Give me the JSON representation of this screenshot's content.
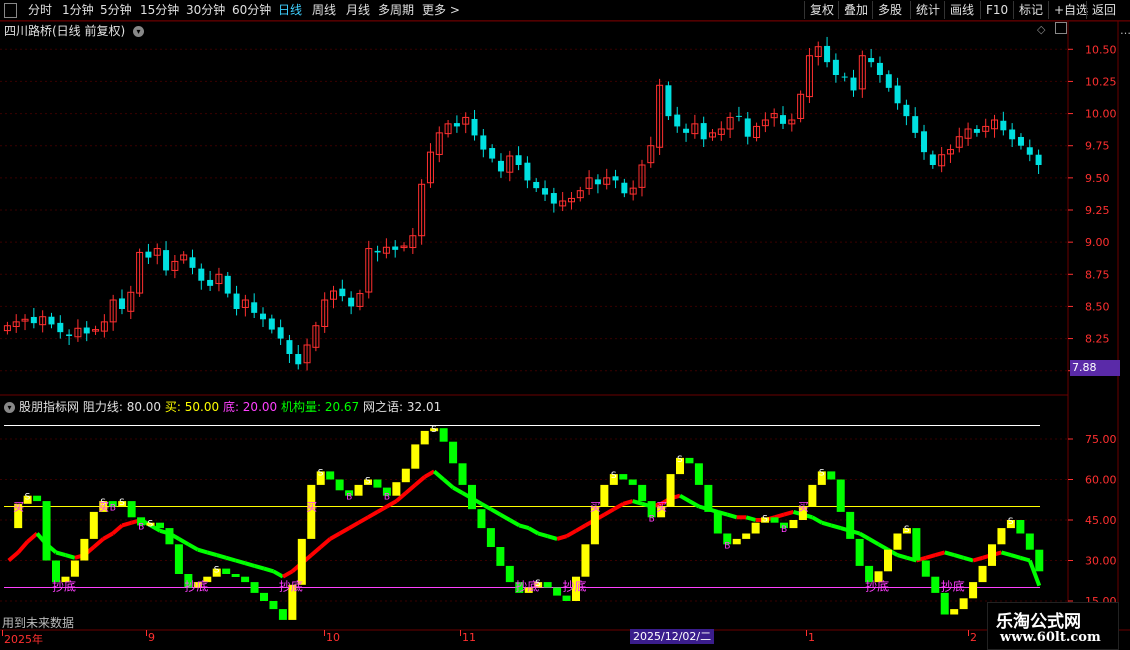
{
  "toolbar": {
    "timeframes": [
      {
        "label": "分时"
      },
      {
        "label": "1分钟"
      },
      {
        "label": "5分钟"
      },
      {
        "label": "15分钟"
      },
      {
        "label": "30分钟"
      },
      {
        "label": "60分钟"
      },
      {
        "label": "日线",
        "active": true
      },
      {
        "label": "周线"
      },
      {
        "label": "月线"
      },
      {
        "label": "多周期"
      },
      {
        "label": "更多 >"
      }
    ],
    "right_buttons": [
      "复权",
      "叠加",
      "多股",
      "统计",
      "画线",
      "F10",
      "标记",
      "+自选",
      "返回"
    ]
  },
  "main": {
    "title": "四川路桥(日线 前复权)",
    "price_tag": "7.88",
    "y_ticks": [
      "10.50",
      "10.25",
      "10.00",
      "9.75",
      "9.50",
      "9.25",
      "9.00",
      "8.75",
      "8.50",
      "8.25",
      "8.00"
    ]
  },
  "indicator": {
    "name": "股朋指标网",
    "resist": "阻力线: 80.00",
    "buy": "买: 50.00",
    "bottom": "底: 20.00",
    "inst": "机构量: 20.67",
    "net": "网之语: 32.01",
    "y_ticks": [
      "75.00",
      "60.00",
      "45.00",
      "30.00",
      "15.00"
    ],
    "bottom_label": "抄底",
    "buy_label": "买",
    "s_label": "S",
    "b_label": "B"
  },
  "x_axis": {
    "labels": [
      "2025年",
      "9",
      "10",
      "11",
      "1",
      "2"
    ],
    "cursor_date": "2025/12/02/二"
  },
  "footer": {
    "future_text": "用到未来数据"
  },
  "watermark": {
    "line1": "乐淘公式网",
    "line2": "www.60lt.com"
  },
  "colors": {
    "up": "#ff3030",
    "down": "#00e0e0",
    "yellow": "#ffff00",
    "green": "#00ff00",
    "red": "#ff0000",
    "magenta": "#ff40ff",
    "white": "#ffffff"
  },
  "chart_data": [
    {
      "type": "candlestick",
      "title": "四川路桥(日线 前复权)",
      "ylim": [
        7.85,
        10.65
      ],
      "close": [
        8.35,
        8.38,
        8.4,
        8.37,
        8.42,
        8.36,
        8.3,
        8.27,
        8.33,
        8.29,
        8.32,
        8.38,
        8.55,
        8.48,
        8.61,
        8.92,
        8.88,
        8.95,
        8.78,
        8.85,
        8.9,
        8.8,
        8.7,
        8.66,
        8.75,
        8.6,
        8.48,
        8.55,
        8.45,
        8.4,
        8.32,
        8.25,
        8.13,
        8.05,
        8.2,
        8.35,
        8.55,
        8.62,
        8.58,
        8.5,
        8.6,
        8.95,
        8.92,
        8.96,
        8.94,
        8.97,
        9.05,
        9.45,
        9.7,
        9.85,
        9.92,
        9.9,
        9.97,
        9.83,
        9.72,
        9.65,
        9.55,
        9.67,
        9.6,
        9.48,
        9.42,
        9.37,
        9.3,
        9.32,
        9.34,
        9.4,
        9.5,
        9.45,
        9.5,
        9.48,
        9.38,
        9.42,
        9.6,
        9.75,
        10.22,
        9.98,
        9.9,
        9.85,
        9.92,
        9.8,
        9.85,
        9.88,
        9.97,
        9.98,
        9.82,
        9.9,
        9.95,
        10.0,
        9.92,
        9.95,
        10.15,
        10.45,
        10.52,
        10.4,
        10.3,
        10.28,
        10.18,
        10.45,
        10.4,
        10.3,
        10.2,
        10.08,
        9.98,
        9.85,
        9.7,
        9.6,
        9.68,
        9.72,
        9.82,
        9.88,
        9.85,
        9.9,
        9.95,
        9.87,
        9.8,
        9.75,
        9.68,
        9.6
      ],
      "x_labels": [
        "2025年",
        "9",
        "10",
        "11",
        "1",
        "2"
      ]
    },
    {
      "type": "line",
      "title": "股朋指标网",
      "ylim": [
        5,
        85
      ],
      "levels": {
        "resist": 80,
        "buy": 50,
        "bottom": 20
      },
      "series": [
        {
          "name": "网之语",
          "values": [
            42,
            51,
            54,
            52,
            30,
            22,
            24,
            30,
            38,
            48,
            52,
            50,
            52,
            46,
            43,
            44,
            42,
            36,
            25,
            20,
            22,
            24,
            27,
            25,
            24,
            22,
            18,
            15,
            12,
            8,
            21,
            38,
            58,
            63,
            60,
            56,
            54,
            58,
            60,
            57,
            54,
            59,
            64,
            73,
            78,
            79,
            74,
            66,
            58,
            49,
            42,
            35,
            28,
            22,
            18,
            20,
            22,
            20,
            17,
            15,
            24,
            36,
            50,
            58,
            62,
            60,
            58,
            52,
            46,
            50,
            62,
            68,
            66,
            58,
            48,
            40,
            36,
            38,
            40,
            44,
            46,
            44,
            42,
            45,
            50,
            58,
            63,
            60,
            48,
            38,
            28,
            22,
            26,
            34,
            40,
            42,
            30,
            24,
            18,
            10,
            12,
            16,
            22,
            28,
            36,
            42,
            45,
            40,
            34,
            26
          ]
        },
        {
          "name": "机构量",
          "values": [
            30,
            33,
            37,
            40,
            36,
            33,
            32,
            31,
            32,
            35,
            38,
            40,
            43,
            44,
            45,
            43,
            41,
            40,
            38,
            36,
            34,
            33,
            32,
            31,
            30,
            29,
            28,
            27,
            26,
            24,
            26,
            29,
            32,
            35,
            38,
            40,
            42,
            44,
            46,
            48,
            50,
            52,
            55,
            58,
            61,
            63,
            60,
            57,
            55,
            53,
            51,
            49,
            47,
            45,
            43,
            42,
            40,
            39,
            38,
            39,
            41,
            43,
            45,
            47,
            49,
            51,
            52,
            51,
            50,
            51,
            53,
            54,
            52,
            50,
            49,
            48,
            47,
            46,
            46,
            45,
            45,
            46,
            47,
            48,
            47,
            46,
            44,
            43,
            42,
            41,
            40,
            38,
            36,
            34,
            32,
            31,
            30,
            31,
            32,
            33,
            32,
            31,
            30,
            31,
            32,
            33,
            32,
            31,
            30,
            20.67
          ]
        }
      ]
    }
  ]
}
